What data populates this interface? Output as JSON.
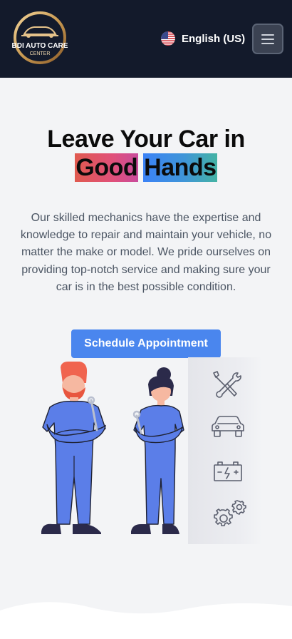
{
  "header": {
    "logo_line1": "BDI AUTO CARE",
    "logo_line2": "CENTER",
    "language_label": "English (US)"
  },
  "hero": {
    "title_line1": "Leave Your Car in",
    "title_word1": "Good",
    "title_word2": "Hands",
    "description": "Our skilled mechanics have the expertise and knowledge to repair and maintain your vehicle, no matter the make or model. We pride ourselves on providing top-notch service and making sure your car is in the best possible condition.",
    "cta_label": "Schedule Appointment"
  },
  "icons": [
    "wrench-screwdriver-icon",
    "car-icon",
    "battery-icon",
    "gears-icon",
    "us-flag-icon",
    "hamburger-menu-icon"
  ],
  "colors": {
    "header_bg": "#131a2b",
    "page_bg": "#f3f4f6",
    "cta_bg": "#4a86ee",
    "uniform": "#5b7ee8"
  }
}
